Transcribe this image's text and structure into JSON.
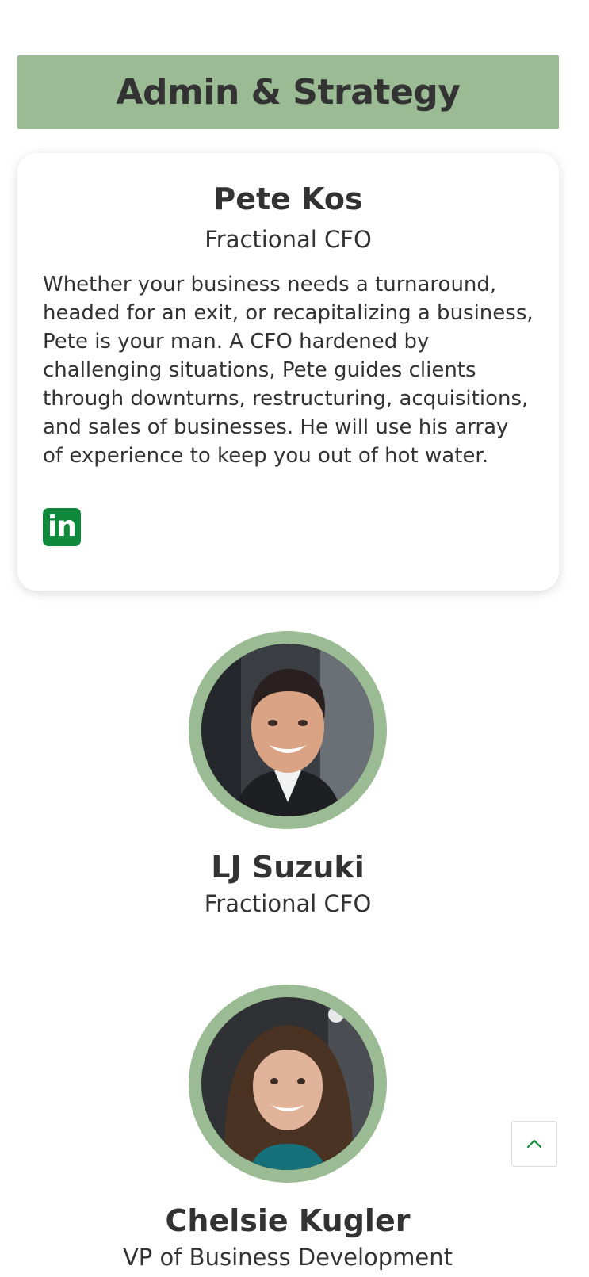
{
  "colors": {
    "section_bg": "#9ABB93",
    "ring": "#9ABB93",
    "linkedin_bg": "#0F8A3C",
    "text": "#333333",
    "accent_green": "#0F8A3C"
  },
  "section": {
    "title": "Admin & Strategy"
  },
  "featured": {
    "name": "Pete Kos",
    "title": "Fractional CFO",
    "bio": "Whether your business needs a turnaround, headed for an exit, or recapitalizing a business, Pete is your man. A CFO hardened by challenging situations, Pete guides clients through downturns, restructuring, acquisitions, and sales of businesses. He will use his array of experience to keep you out of hot water.",
    "social_icon": "linkedin-icon",
    "social_label": "in"
  },
  "members": [
    {
      "name": "LJ Suzuki",
      "title": "Fractional CFO"
    },
    {
      "name": "Chelsie Kugler",
      "title": "VP of Business Development"
    }
  ],
  "back_to_top": {
    "icon": "chevron-up-icon"
  }
}
